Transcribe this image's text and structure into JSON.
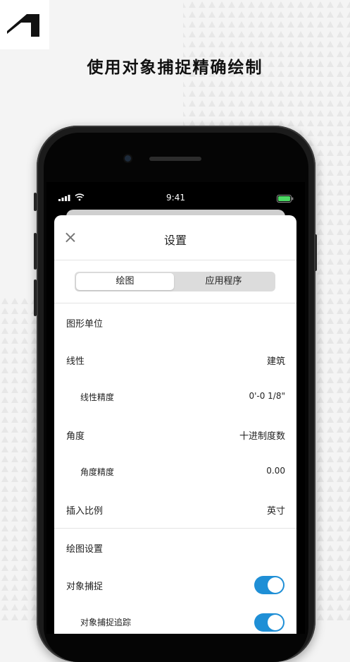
{
  "headline": "使用对象捕捉精确绘制",
  "status_bar": {
    "time": "9:41"
  },
  "sheet": {
    "title": "设置",
    "tabs": [
      {
        "label": "绘图",
        "active": true
      },
      {
        "label": "应用程序",
        "active": false
      }
    ]
  },
  "sections": {
    "graphic_units": {
      "title": "图形单位",
      "linear": {
        "label": "线性",
        "value": "建筑"
      },
      "linear_precision": {
        "label": "线性精度",
        "value": "0'-0 1/8\""
      },
      "angle": {
        "label": "角度",
        "value": "十进制度数"
      },
      "angle_precision": {
        "label": "角度精度",
        "value": "0.00"
      },
      "insert_scale": {
        "label": "插入比例",
        "value": "英寸"
      }
    },
    "drawing_settings": {
      "title": "绘图设置",
      "object_snap": {
        "label": "对象捕捉",
        "on": true
      },
      "object_snap_tracking": {
        "label": "对象捕捉追踪",
        "on": true
      }
    }
  },
  "colors": {
    "toggle_on": "#1f8fd6",
    "battery": "#4cd964"
  }
}
